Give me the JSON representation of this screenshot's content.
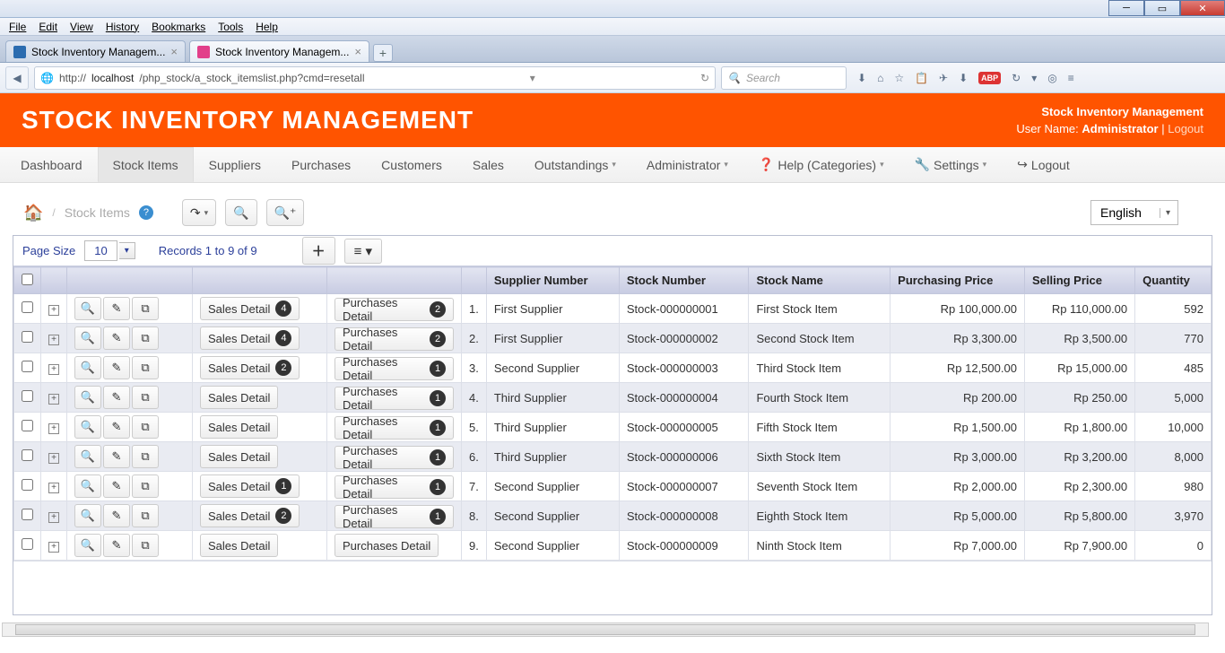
{
  "os_menu": [
    "File",
    "Edit",
    "View",
    "History",
    "Bookmarks",
    "Tools",
    "Help"
  ],
  "tabs": [
    {
      "label": "Stock Inventory Managem..."
    },
    {
      "label": "Stock Inventory Managem..."
    }
  ],
  "url": {
    "pre": "http://",
    "host": "localhost",
    "path": "/php_stock/a_stock_itemslist.php?cmd=resetall"
  },
  "search_placeholder": "Search",
  "header": {
    "title": "STOCK INVENTORY MANAGEMENT",
    "app_name": "Stock Inventory Management",
    "user_label": "User Name:",
    "user": "Administrator",
    "logout": "Logout"
  },
  "nav": {
    "items": [
      "Dashboard",
      "Stock Items",
      "Suppliers",
      "Purchases",
      "Customers",
      "Sales",
      "Outstandings",
      "Administrator",
      "Help (Categories)",
      "Settings",
      "Logout"
    ],
    "active": "Stock Items"
  },
  "breadcrumb": {
    "text": "Stock Items"
  },
  "language": "English",
  "grid_top": {
    "page_size_label": "Page Size",
    "page_size": "10",
    "records": "Records 1 to 9 of 9"
  },
  "columns": [
    "Supplier Number",
    "Stock Number",
    "Stock Name",
    "Purchasing Price",
    "Selling Price",
    "Quantity"
  ],
  "sales_label": "Sales Detail",
  "purch_label": "Purchases Detail",
  "rows": [
    {
      "n": "1.",
      "supplier": "First Supplier",
      "stock": "Stock-000000001",
      "name": "First Stock Item",
      "pp": "Rp 100,000.00",
      "sp": "Rp 110,000.00",
      "qty": "592",
      "sales": "4",
      "purch": "2"
    },
    {
      "n": "2.",
      "supplier": "First Supplier",
      "stock": "Stock-000000002",
      "name": "Second Stock Item",
      "pp": "Rp 3,300.00",
      "sp": "Rp 3,500.00",
      "qty": "770",
      "sales": "4",
      "purch": "2"
    },
    {
      "n": "3.",
      "supplier": "Second Supplier",
      "stock": "Stock-000000003",
      "name": "Third Stock Item",
      "pp": "Rp 12,500.00",
      "sp": "Rp 15,000.00",
      "qty": "485",
      "sales": "2",
      "purch": "1"
    },
    {
      "n": "4.",
      "supplier": "Third Supplier",
      "stock": "Stock-000000004",
      "name": "Fourth Stock Item",
      "pp": "Rp 200.00",
      "sp": "Rp 250.00",
      "qty": "5,000",
      "sales": "",
      "purch": "1"
    },
    {
      "n": "5.",
      "supplier": "Third Supplier",
      "stock": "Stock-000000005",
      "name": "Fifth Stock Item",
      "pp": "Rp 1,500.00",
      "sp": "Rp 1,800.00",
      "qty": "10,000",
      "sales": "",
      "purch": "1"
    },
    {
      "n": "6.",
      "supplier": "Third Supplier",
      "stock": "Stock-000000006",
      "name": "Sixth Stock Item",
      "pp": "Rp 3,000.00",
      "sp": "Rp 3,200.00",
      "qty": "8,000",
      "sales": "",
      "purch": "1"
    },
    {
      "n": "7.",
      "supplier": "Second Supplier",
      "stock": "Stock-000000007",
      "name": "Seventh Stock Item",
      "pp": "Rp 2,000.00",
      "sp": "Rp 2,300.00",
      "qty": "980",
      "sales": "1",
      "purch": "1"
    },
    {
      "n": "8.",
      "supplier": "Second Supplier",
      "stock": "Stock-000000008",
      "name": "Eighth Stock Item",
      "pp": "Rp 5,000.00",
      "sp": "Rp 5,800.00",
      "qty": "3,970",
      "sales": "2",
      "purch": "1"
    },
    {
      "n": "9.",
      "supplier": "Second Supplier",
      "stock": "Stock-000000009",
      "name": "Ninth Stock Item",
      "pp": "Rp 7,000.00",
      "sp": "Rp 7,900.00",
      "qty": "0",
      "sales": "",
      "purch": ""
    }
  ]
}
